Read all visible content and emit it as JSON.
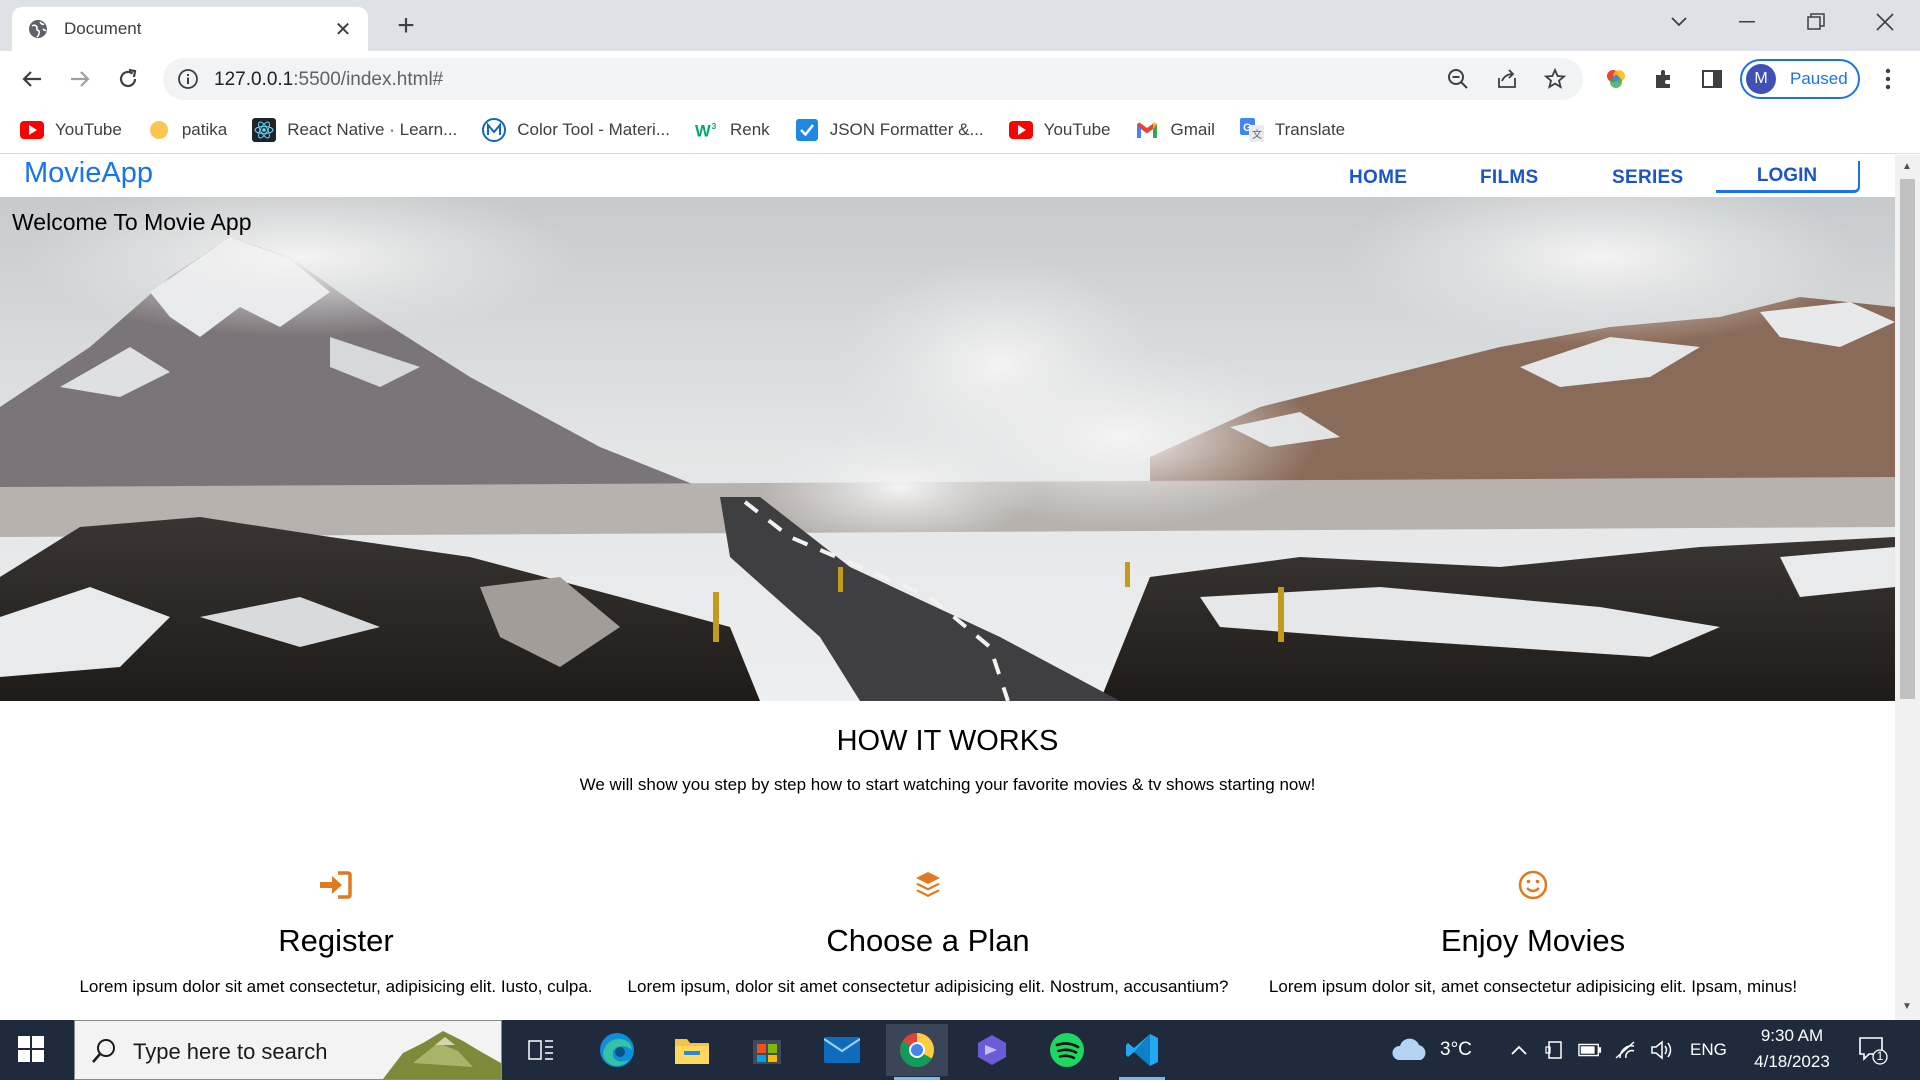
{
  "browser": {
    "tab_title": "Document",
    "url_host": "127.0.0.1",
    "url_rest": ":5500/index.html#",
    "profile_initial": "M",
    "profile_label": "Paused",
    "bookmarks": [
      {
        "label": "YouTube",
        "icon": "youtube-icon"
      },
      {
        "label": "patika",
        "icon": "patika-icon"
      },
      {
        "label": "React Native · Learn...",
        "icon": "react-icon"
      },
      {
        "label": "Color Tool - Materi...",
        "icon": "material-icon"
      },
      {
        "label": "Renk",
        "icon": "w3-icon"
      },
      {
        "label": "JSON Formatter &...",
        "icon": "checkbox-icon"
      },
      {
        "label": "YouTube",
        "icon": "youtube-icon"
      },
      {
        "label": "Gmail",
        "icon": "gmail-icon"
      },
      {
        "label": "Translate",
        "icon": "translate-icon"
      }
    ]
  },
  "site": {
    "brand": "MovieApp",
    "nav": {
      "home": "HOME",
      "films": "FILMS",
      "series": "SERIES",
      "login": "LOGIN"
    },
    "hero_title": "Welcome To Movie App",
    "how_title": "HOW IT WORKS",
    "how_subtitle": "We will show you step by step how to start watching your favorite movies & tv shows starting now!",
    "steps": [
      {
        "title": "Register",
        "desc": "Lorem ipsum dolor sit amet consectetur, adipisicing elit. Iusto, culpa.",
        "icon": "sign-in-icon"
      },
      {
        "title": "Choose a Plan",
        "desc": "Lorem ipsum, dolor sit amet consectetur adipisicing elit. Nostrum, accusantium?",
        "icon": "layers-icon"
      },
      {
        "title": "Enjoy Movies",
        "desc": "Lorem ipsum dolor sit, amet consectetur adipisicing elit. Ipsam, minus!",
        "icon": "smile-icon"
      }
    ],
    "accent": "#e07a1f",
    "link_color": "#1a56c9"
  },
  "taskbar": {
    "search_placeholder": "Type here to search",
    "weather": "3°C",
    "language": "ENG",
    "time": "9:30 AM",
    "date": "4/18/2023",
    "notification_count": "1"
  }
}
